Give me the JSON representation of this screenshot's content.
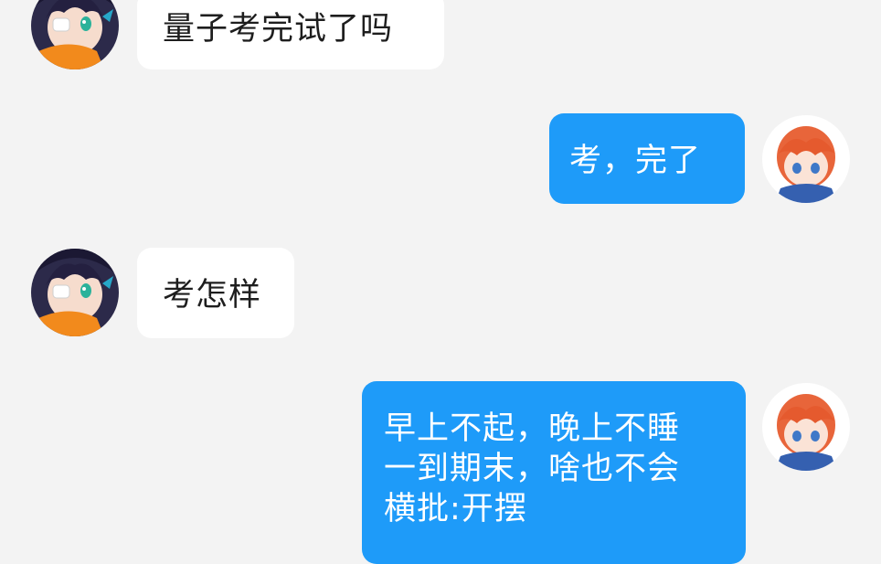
{
  "chat": {
    "messages": [
      {
        "sender": "other",
        "avatar_icon": "anime-girl-avatar-icon",
        "lines": [
          "量子考完试了吗"
        ]
      },
      {
        "sender": "self",
        "avatar_icon": "anime-boy-avatar-icon",
        "lines": [
          "考，完了"
        ]
      },
      {
        "sender": "other",
        "avatar_icon": "anime-girl-avatar-icon",
        "lines": [
          "考怎样"
        ]
      },
      {
        "sender": "self",
        "avatar_icon": "anime-boy-avatar-icon",
        "lines": [
          "早上不起，晚上不睡",
          "一到期末，啥也不会",
          "横批:开摆"
        ]
      }
    ]
  },
  "colors": {
    "background": "#f3f3f3",
    "self_bubble": "#1e9bf9",
    "other_bubble": "#ffffff",
    "self_text": "#ffffff",
    "other_text": "#1e1e1e"
  }
}
